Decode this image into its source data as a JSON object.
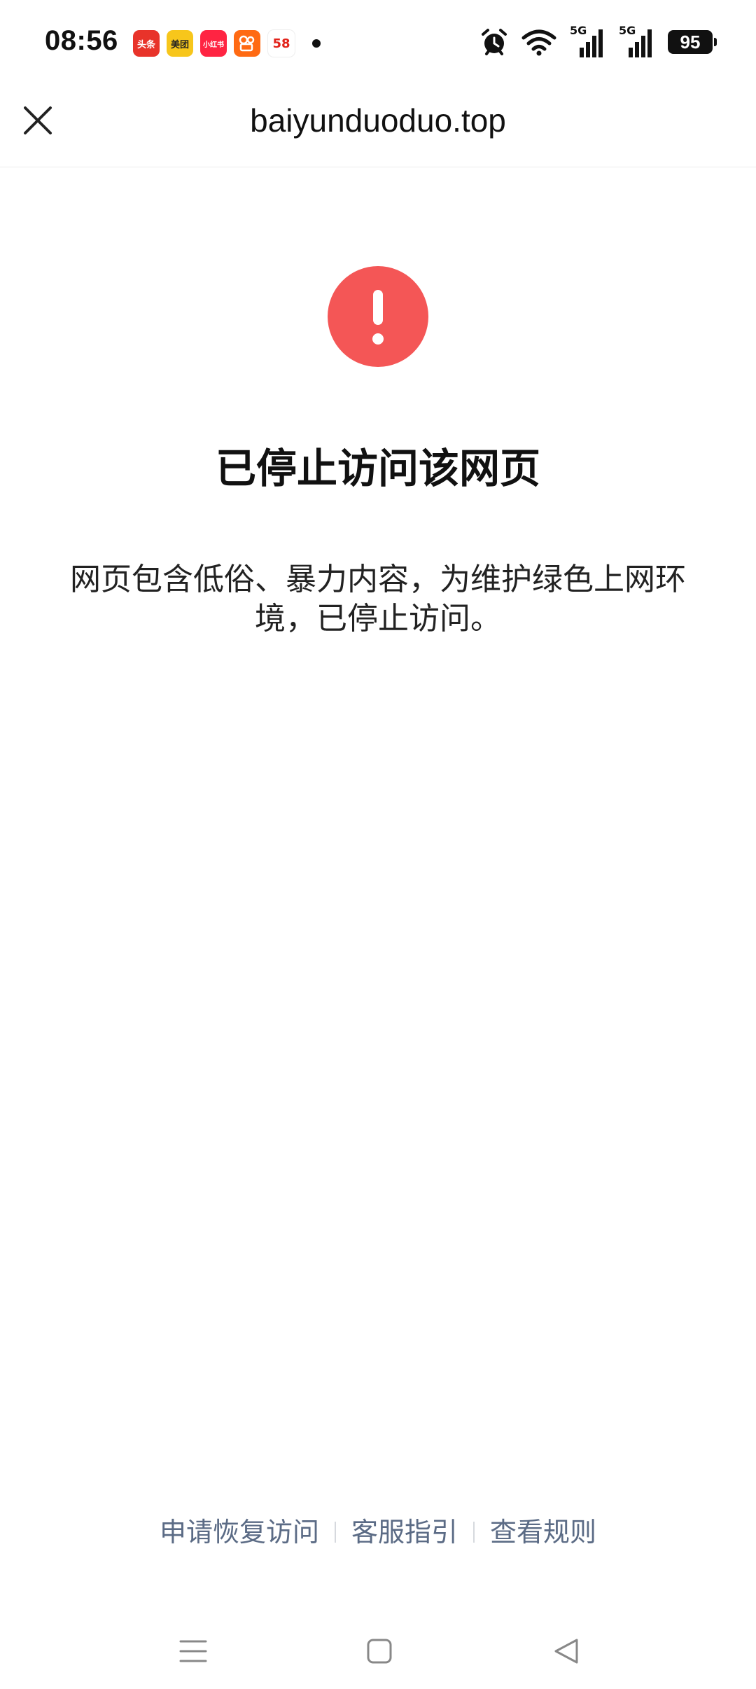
{
  "status_bar": {
    "time": "08:56",
    "apps": [
      {
        "name": "toutiao-icon",
        "label": "头条",
        "color": "#e8332a"
      },
      {
        "name": "meituan-icon",
        "label": "美团",
        "color": "#f7c61b"
      },
      {
        "name": "xiaohongshu-icon",
        "label": "小红书",
        "color": "#ff2442"
      },
      {
        "name": "kuaishou-icon",
        "label": "",
        "color": "#ff6a13"
      },
      {
        "name": "58-icon",
        "label": "58",
        "color": "#ffffff"
      }
    ],
    "network_1": "5G",
    "network_2": "5G",
    "battery": "95"
  },
  "title_bar": {
    "url": "baiyunduoduo.top"
  },
  "main": {
    "title": "已停止访问该网页",
    "description": "网页包含低俗、暴力内容，为维护绿色上网环境，已停止访问。"
  },
  "footer": {
    "links": [
      "申请恢复访问",
      "客服指引",
      "查看规则"
    ]
  },
  "colors": {
    "alert": "#f45656",
    "link": "#5b6b85"
  }
}
